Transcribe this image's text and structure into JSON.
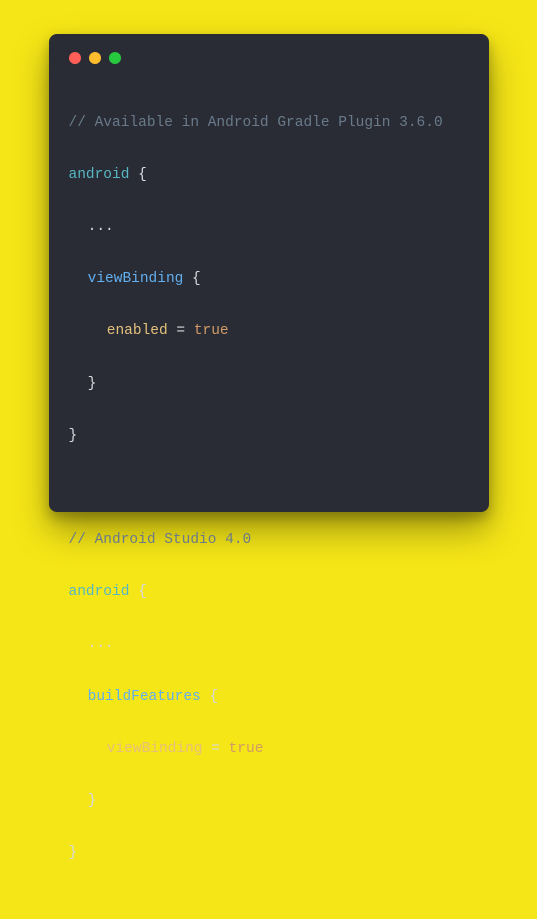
{
  "titlebar": {
    "close": "close",
    "minimize": "minimize",
    "zoom": "zoom"
  },
  "code": {
    "block1": {
      "comment": "// Available in Android Gradle Plugin 3.6.0",
      "root": "android",
      "ellipsis": "...",
      "section": "viewBinding",
      "prop": "enabled",
      "assign": " = ",
      "val": "true"
    },
    "block2": {
      "comment": "// Android Studio 4.0",
      "root": "android",
      "ellipsis": "...",
      "section": "buildFeatures",
      "prop": "viewBinding",
      "assign": " = ",
      "val": "true"
    },
    "brace_open": " {",
    "brace_close": "}"
  }
}
